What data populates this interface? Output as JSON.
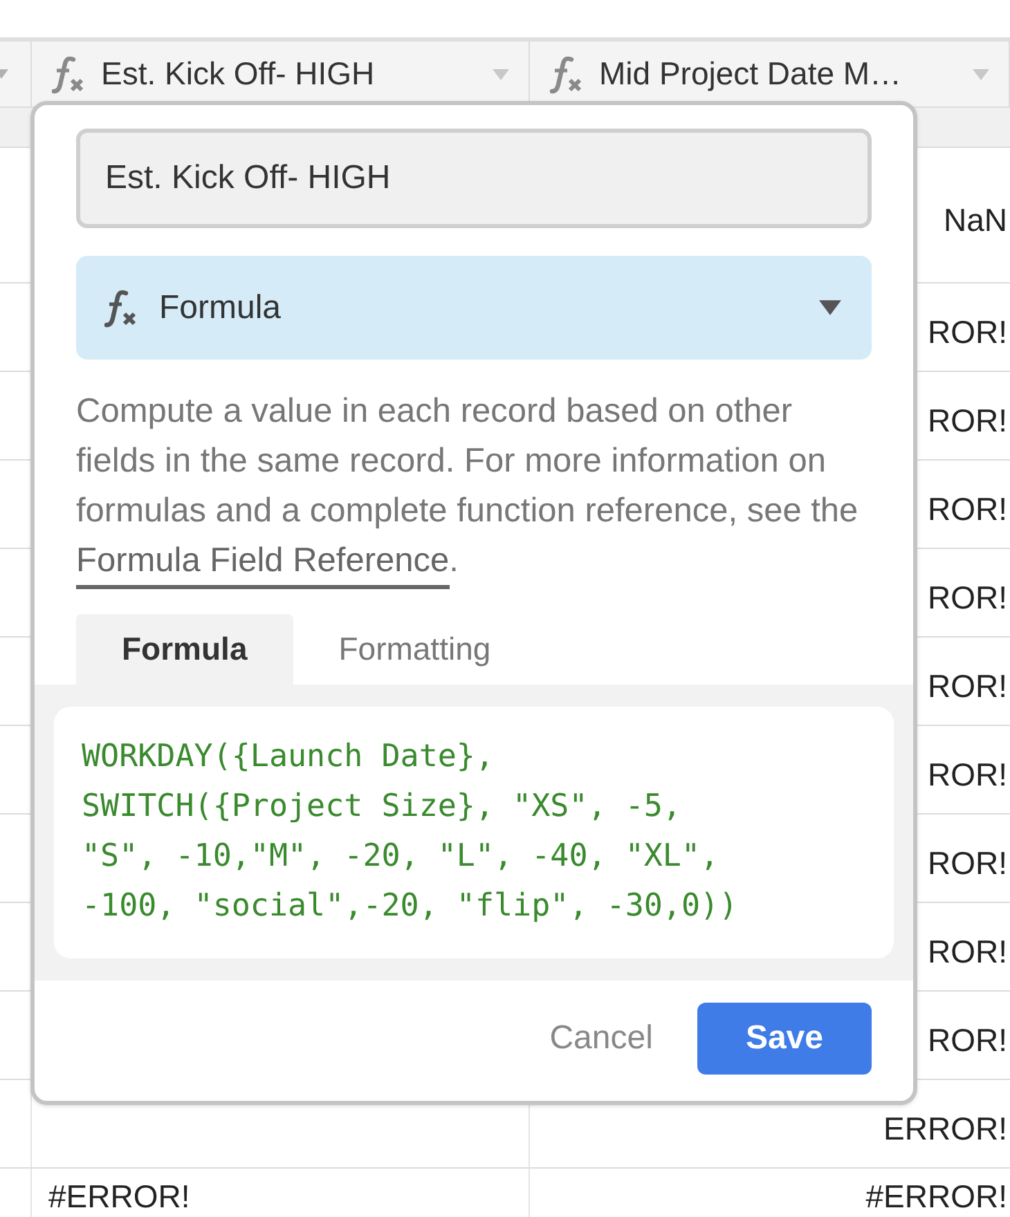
{
  "table": {
    "columns": [
      {
        "kind": "formula",
        "title": "Est. Kick Off- HIGH"
      },
      {
        "kind": "formula",
        "title": "Mid Project Date M…"
      }
    ],
    "rows": [
      {
        "column_3": "NaN",
        "tall": true
      },
      {
        "column_3": "ROR!",
        "tall": false
      },
      {
        "column_3": "ROR!",
        "tall": false
      },
      {
        "column_3": "ROR!",
        "tall": false
      },
      {
        "column_3": "ROR!",
        "tall": false
      },
      {
        "column_3": "ROR!",
        "tall": false
      },
      {
        "column_3": "ROR!",
        "tall": false
      },
      {
        "column_3": "ROR!",
        "tall": false
      },
      {
        "column_3": "ROR!",
        "tall": false
      },
      {
        "column_3": "ROR!",
        "tall": false
      },
      {
        "column_3": "ERROR!",
        "tall": false
      },
      {
        "column_1": "#ERROR!",
        "column_3": "#ERROR!",
        "tall": false
      }
    ]
  },
  "dialog": {
    "field_name": "Est. Kick Off- HIGH",
    "field_type": "Formula",
    "description": {
      "text": "Compute a value in each record based on other fields in the same record. For more information on formulas and a complete function reference, see the ",
      "link": "Formula Field Reference",
      "end": "."
    },
    "tabs": [
      {
        "label": "Formula",
        "selected": true
      },
      {
        "label": "Formatting",
        "selected": false
      }
    ],
    "formula": "WORKDAY({Launch Date},\nSWITCH({Project Size}, \"XS\", -5,\n\"S\", -10,\"M\", -20, \"L\", -40, \"XL\",\n-100, \"social\",-20, \"flip\", -30,0))",
    "buttons": {
      "cancel": "Cancel",
      "save": "Save"
    }
  }
}
